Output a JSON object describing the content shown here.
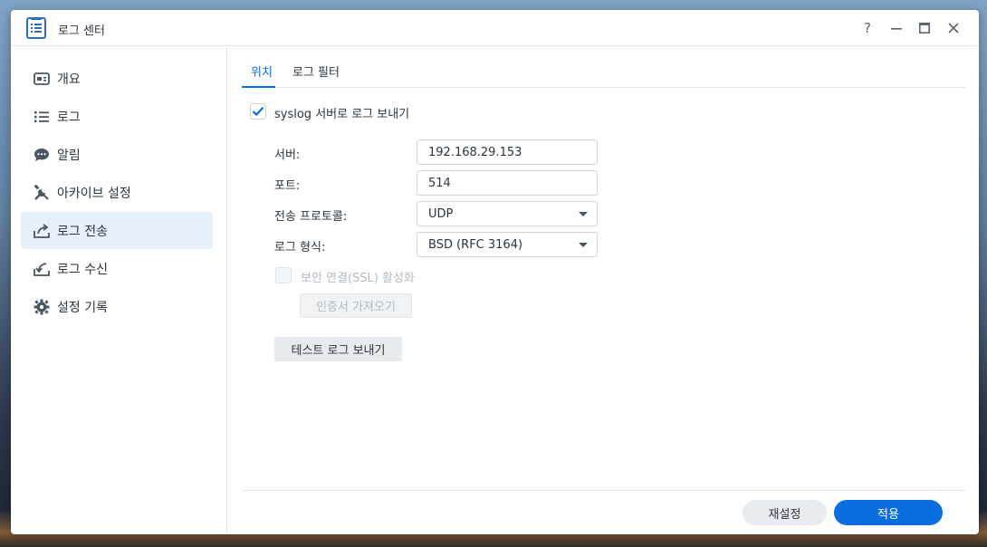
{
  "window": {
    "title": "로그 센터",
    "controls": {
      "help": "?"
    }
  },
  "sidebar": {
    "items": [
      {
        "label": "개요",
        "icon": "overview-icon"
      },
      {
        "label": "로그",
        "icon": "list-icon"
      },
      {
        "label": "알림",
        "icon": "chat-bubble-icon"
      },
      {
        "label": "아카이브 설정",
        "icon": "tools-icon"
      },
      {
        "label": "로그 전송",
        "icon": "upload-icon",
        "active": true
      },
      {
        "label": "로그 수신",
        "icon": "download-icon"
      },
      {
        "label": "설정 기록",
        "icon": "gear-icon"
      }
    ]
  },
  "tabs": [
    {
      "label": "위치",
      "active": true
    },
    {
      "label": "로그 필터"
    }
  ],
  "form": {
    "syslog_checkbox_label": "syslog 서버로 로그 보내기",
    "syslog_checked": true,
    "server_label": "서버:",
    "server_value": "192.168.29.153",
    "port_label": "포트:",
    "port_value": "514",
    "protocol_label": "전송 프로토콜:",
    "protocol_value": "UDP",
    "format_label": "로그 형식:",
    "format_value": "BSD (RFC 3164)",
    "ssl_label": "보안 연결(SSL) 활성화",
    "ssl_checked": false,
    "import_cert_button": "인증서 가져오기",
    "test_log_button": "테스트 로그 보내기"
  },
  "footer": {
    "reset_button": "재설정",
    "apply_button": "적용"
  },
  "colors": {
    "accent": "#0a6ee0",
    "active_nav_bg": "#e6effa"
  }
}
